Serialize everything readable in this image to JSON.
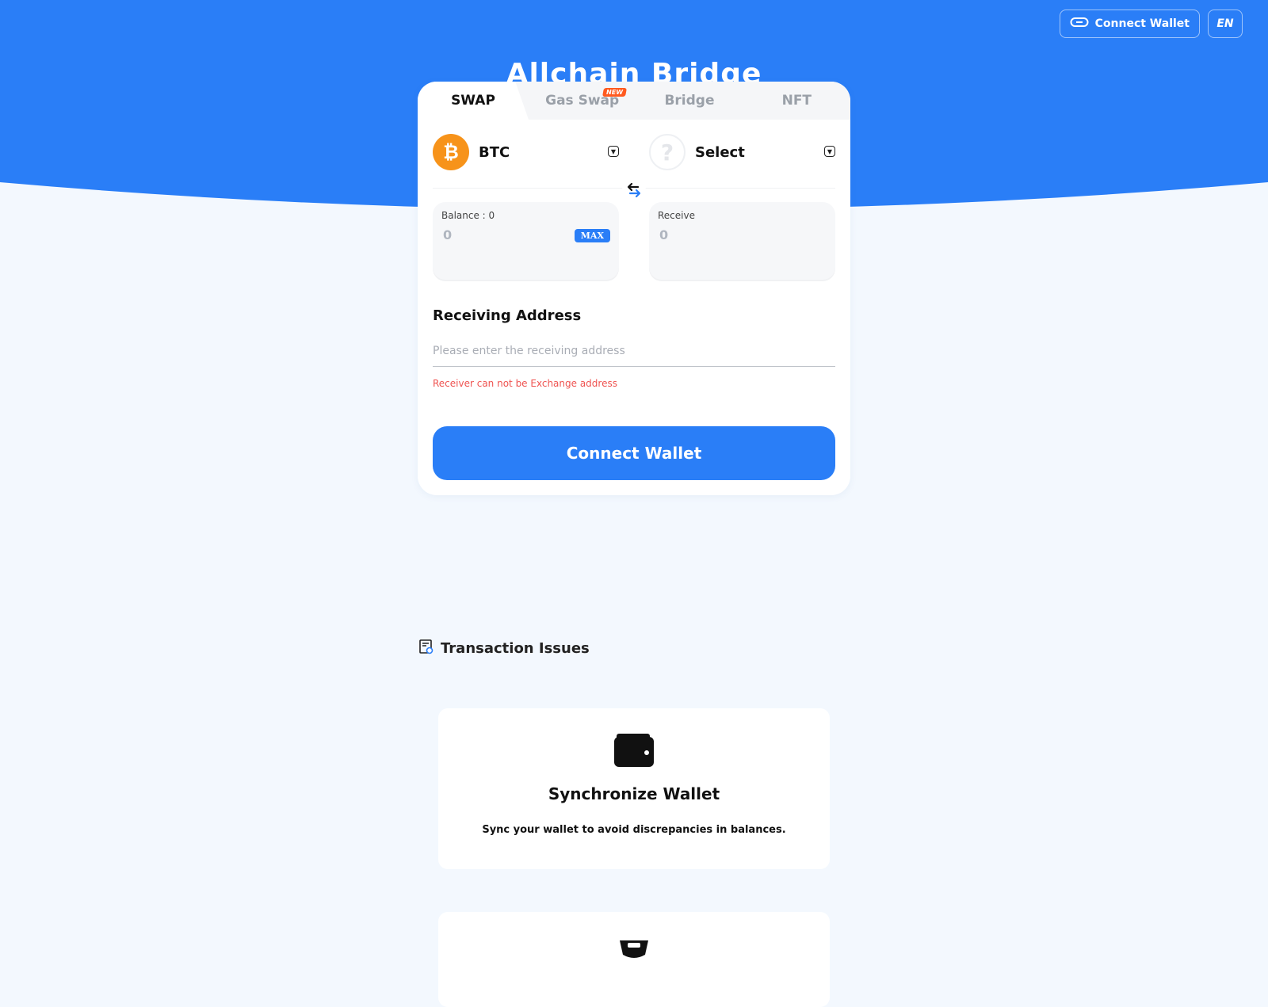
{
  "header": {
    "connect_wallet_label": "Connect Wallet",
    "language": "EN",
    "title": "Allchain Bridge"
  },
  "tabs": [
    {
      "label": "SWAP",
      "active": true
    },
    {
      "label": "Gas Swap",
      "badge": "NEW"
    },
    {
      "label": "Bridge"
    },
    {
      "label": "NFT"
    }
  ],
  "from_token": {
    "symbol": "BTC",
    "icon": "bitcoin-icon"
  },
  "to_token": {
    "symbol": "Select",
    "icon": "question-icon"
  },
  "from_amount": {
    "label": "Balance : 0",
    "value": "0",
    "max_label": "MAX"
  },
  "to_amount": {
    "label": "Receive",
    "value": "0"
  },
  "receiving": {
    "title": "Receiving Address",
    "placeholder": "Please enter the receiving address",
    "error": "Receiver can not be Exchange address"
  },
  "connect_button_label": "Connect Wallet",
  "issues": {
    "title": "Transaction Issues",
    "cards": [
      {
        "title": "Synchronize Wallet",
        "description": "Sync your wallet to avoid discrepancies in balances.",
        "icon": "wallet-icon"
      },
      {
        "title": "",
        "description": "",
        "icon": "bucket-icon"
      }
    ]
  },
  "colors": {
    "primary": "#2a7ef7",
    "background": "#f3f8fe",
    "error": "#ef5350",
    "btc": "#f7931a",
    "badge": "#ff5a1f"
  }
}
